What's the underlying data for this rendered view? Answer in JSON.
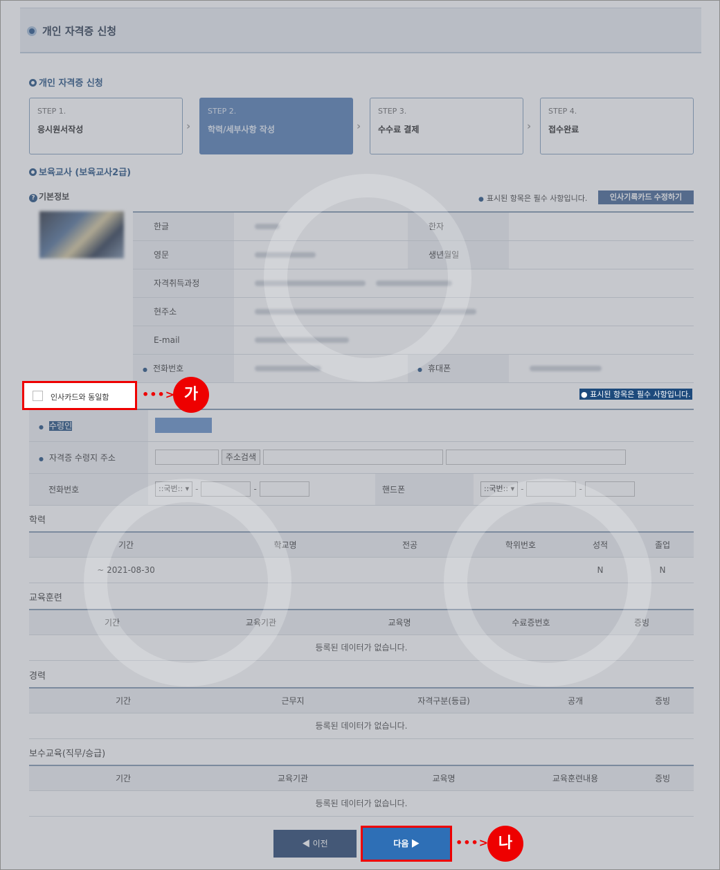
{
  "page_title": "개인 자격증 신청",
  "section_title": "개인 자격증 신청",
  "steps": [
    {
      "no": "STEP 1.",
      "name": "응시원서작성"
    },
    {
      "no": "STEP 2.",
      "name": "학력/세부사항 작성"
    },
    {
      "no": "STEP 3.",
      "name": "수수료 결제"
    },
    {
      "no": "STEP 4.",
      "name": "접수완료"
    }
  ],
  "cert_title": "보육교사 (보육교사2급)",
  "basic_info": {
    "title": "기본정보",
    "required_note": "표시된 항목은 필수 사항입니다.",
    "edit_button": "인사기록카드 수정하기",
    "labels": {
      "korean": "한글",
      "hanja": "한자",
      "english": "영문",
      "birth": "생년월일",
      "course": "자격취득과정",
      "address": "현주소",
      "email": "E-mail",
      "phone": "전화번호",
      "mobile": "휴대폰"
    }
  },
  "same_as_card": "인사카드와 동일함",
  "marker_a": "가",
  "marker_b": "나",
  "recipient": {
    "required_note": "표시된 항목은 필수 사항입니다.",
    "name_label": "수령인",
    "address_label": "자격증 수령지 주소",
    "address_search": "주소검색",
    "phone_label": "전화번호",
    "phone_select": "::국번::",
    "mobile_label": "핸드폰",
    "mobile_select": "::국번::"
  },
  "education": {
    "title": "학력",
    "headers": [
      "기간",
      "학교명",
      "전공",
      "학위번호",
      "성적",
      "졸업"
    ],
    "rows": [
      [
        "~ 2021-08-30",
        "",
        "",
        "",
        "N",
        "N"
      ]
    ]
  },
  "training": {
    "title": "교육훈련",
    "headers": [
      "기간",
      "교육기관",
      "교육명",
      "수료증번호",
      "증빙"
    ],
    "empty": "등록된 데이터가 없습니다."
  },
  "career": {
    "title": "경력",
    "headers": [
      "기간",
      "근무지",
      "자격구분(등급)",
      "공개",
      "증빙"
    ],
    "empty": "등록된 데이터가 없습니다."
  },
  "refresher": {
    "title": "보수교육(직무/승급)",
    "headers": [
      "기간",
      "교육기관",
      "교육명",
      "교육훈련내용",
      "증빙"
    ],
    "empty": "등록된 데이터가 없습니다."
  },
  "buttons": {
    "prev": "◀ 이전",
    "next": "다음 ▶"
  },
  "colors": {
    "highlight": "#ee0000",
    "navy": "#1d4a7c",
    "active_step": "#4f79b1"
  }
}
